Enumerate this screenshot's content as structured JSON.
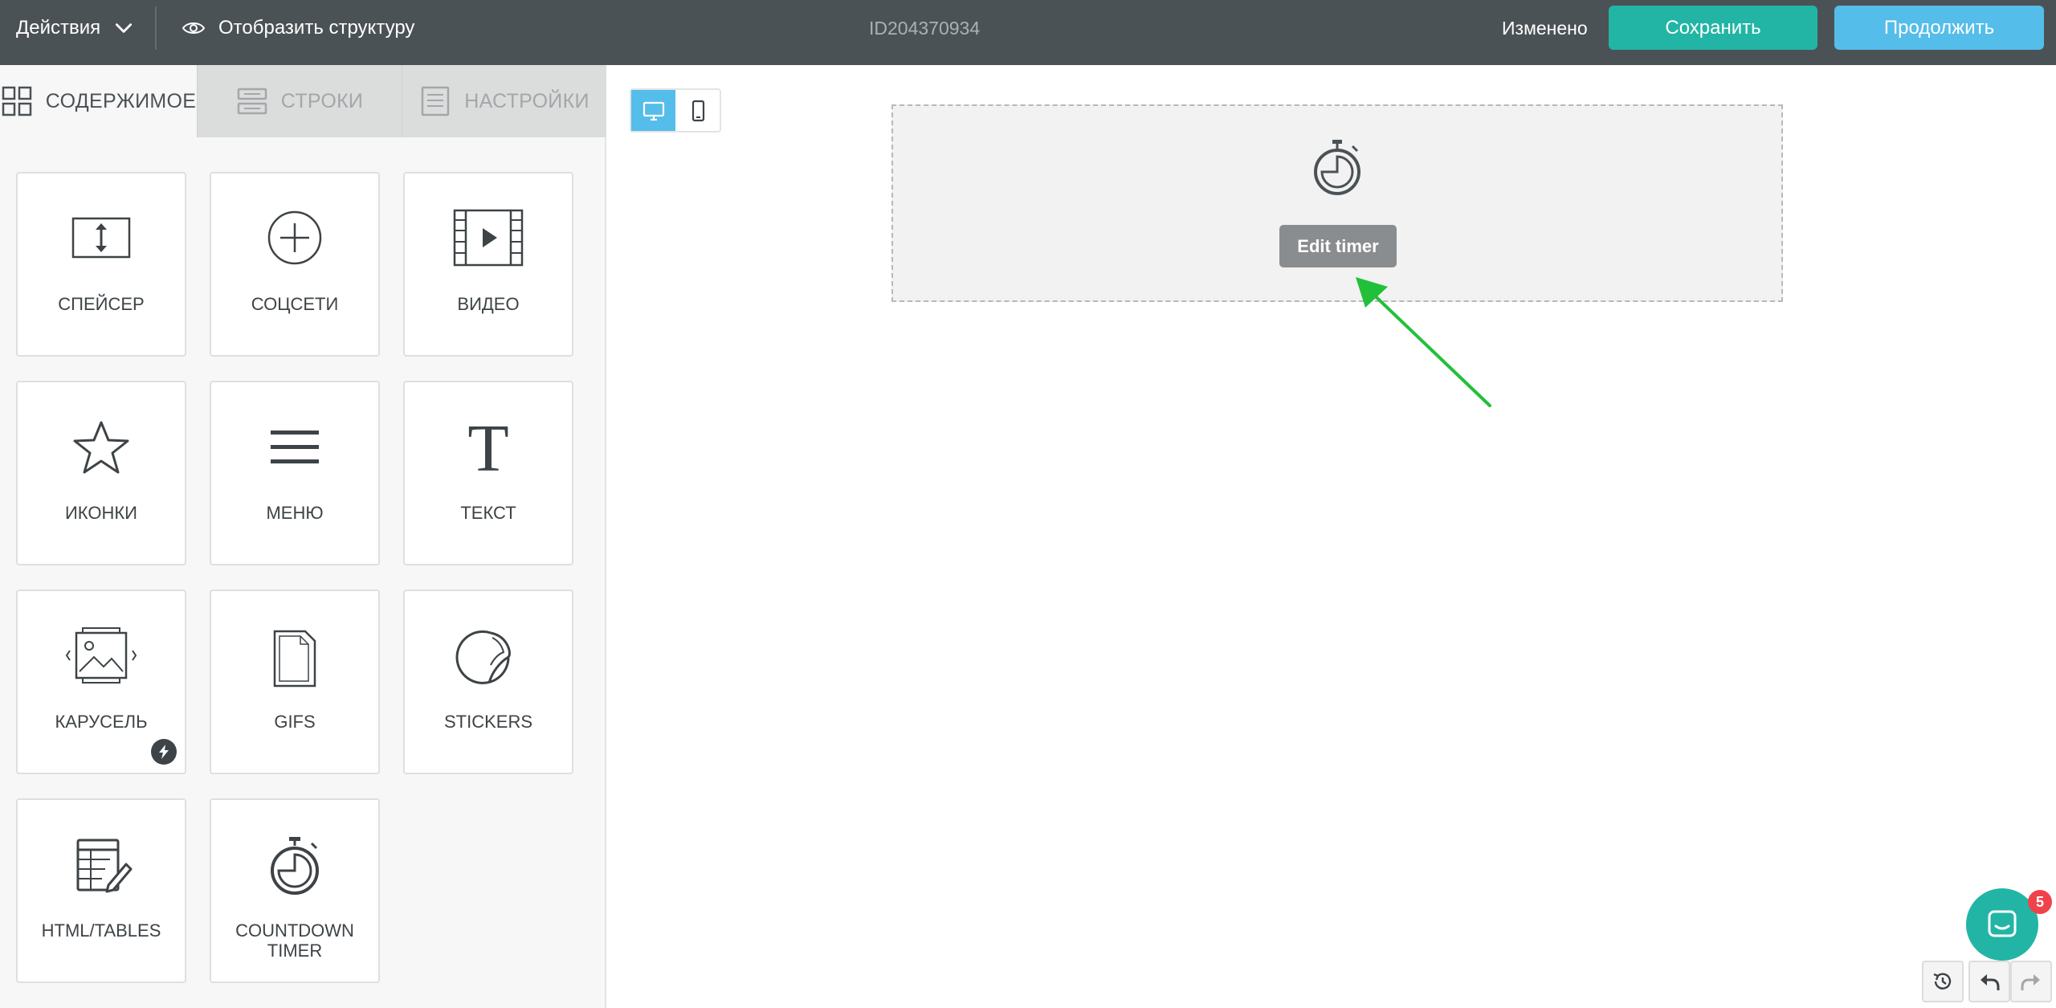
{
  "topbar": {
    "actions_label": "Действия",
    "structure_label": "Отобразить структуру",
    "document_id": "ID204370934",
    "status": "Изменено",
    "save_label": "Сохранить",
    "continue_label": "Продолжить"
  },
  "sidebar": {
    "tabs": [
      {
        "label": "СОДЕРЖИМОЕ",
        "icon": "grid-icon",
        "active": true
      },
      {
        "label": "СТРОКИ",
        "icon": "rows-icon",
        "active": false
      },
      {
        "label": "НАСТРОЙКИ",
        "icon": "settings-doc-icon",
        "active": false
      }
    ],
    "tiles": [
      {
        "label": "СПЕЙСЕР",
        "icon": "spacer-icon"
      },
      {
        "label": "СОЦСЕТИ",
        "icon": "plus-circle-icon"
      },
      {
        "label": "ВИДЕО",
        "icon": "video-icon"
      },
      {
        "label": "ИКОНКИ",
        "icon": "star-icon"
      },
      {
        "label": "МЕНЮ",
        "icon": "menu-icon"
      },
      {
        "label": "ТЕКСТ",
        "icon": "text-icon"
      },
      {
        "label": "КАРУСЕЛЬ",
        "icon": "carousel-icon",
        "badge": "bolt-icon"
      },
      {
        "label": "GIFS",
        "icon": "gif-file-icon"
      },
      {
        "label": "STICKERS",
        "icon": "sticker-icon"
      },
      {
        "label": "HTML/TABLES",
        "icon": "html-tables-icon"
      },
      {
        "label": "COUNTDOWN TIMER",
        "icon": "stopwatch-icon"
      }
    ]
  },
  "canvas": {
    "device_modes": [
      "desktop-icon",
      "mobile-icon"
    ],
    "active_device": "desktop",
    "timer_block": {
      "icon": "stopwatch-icon",
      "button_label": "Edit timer"
    },
    "annotation": {
      "type": "arrow",
      "color": "#22c03a"
    }
  },
  "footer": {
    "chat_unread": "5",
    "history_buttons": [
      "history-icon",
      "undo-icon",
      "redo-icon"
    ]
  },
  "colors": {
    "topbar": "#4b5256",
    "save": "#22b5a5",
    "continue": "#55bde9",
    "chat": "#22b5a5",
    "badge": "#f0424b"
  }
}
